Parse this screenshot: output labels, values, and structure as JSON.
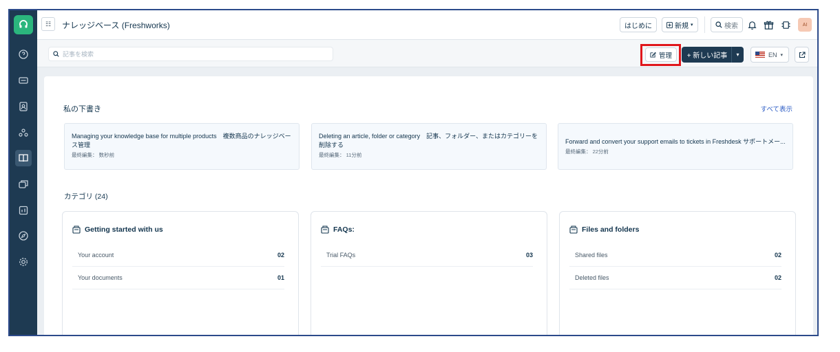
{
  "header": {
    "title": "ナレッジベース (Freshworks)",
    "get_started": "はじめに",
    "new_label": "新規",
    "search_label": "検索",
    "avatar_initial": "AI"
  },
  "sidebar": {
    "icons": [
      "help-icon",
      "tickets-icon",
      "contacts-icon",
      "groups-icon",
      "knowledge-base-icon",
      "conversations-icon",
      "reports-icon",
      "compass-icon",
      "settings-icon"
    ],
    "active": "knowledge-base-icon"
  },
  "subbar": {
    "search_placeholder": "記事を検索",
    "manage_label": "管理",
    "new_article_label": "+ 新しい記事",
    "language": "EN"
  },
  "drafts": {
    "title": "私の下書き",
    "view_all": "すべて表示",
    "items": [
      {
        "title": "Managing your knowledge base for multiple products　複数商品のナレッジベース管理",
        "meta": "最終編集： 数秒前"
      },
      {
        "title": "Deleting an article, folder or category　記事、フォルダー、またはカテゴリーを削除する",
        "meta": "最終編集： 11分前"
      },
      {
        "title": "Forward and convert your support emails to tickets in Freshdesk サポートメー...",
        "meta": "最終編集： 22分前"
      }
    ]
  },
  "categories": {
    "title": "カテゴリ (24)",
    "items": [
      {
        "name": "Getting started with us",
        "folders": [
          {
            "name": "Your account",
            "count": "02"
          },
          {
            "name": "Your documents",
            "count": "01"
          }
        ]
      },
      {
        "name": "FAQs:",
        "folders": [
          {
            "name": "Trial FAQs",
            "count": "03"
          }
        ]
      },
      {
        "name": "Files and folders",
        "folders": [
          {
            "name": "Shared files",
            "count": "02"
          },
          {
            "name": "Deleted files",
            "count": "02"
          }
        ]
      }
    ]
  },
  "colors": {
    "sidebar": "#1e3a52",
    "brand_green": "#2bb67d",
    "highlight_red": "#e0161b",
    "link_blue": "#2c5cc5"
  }
}
